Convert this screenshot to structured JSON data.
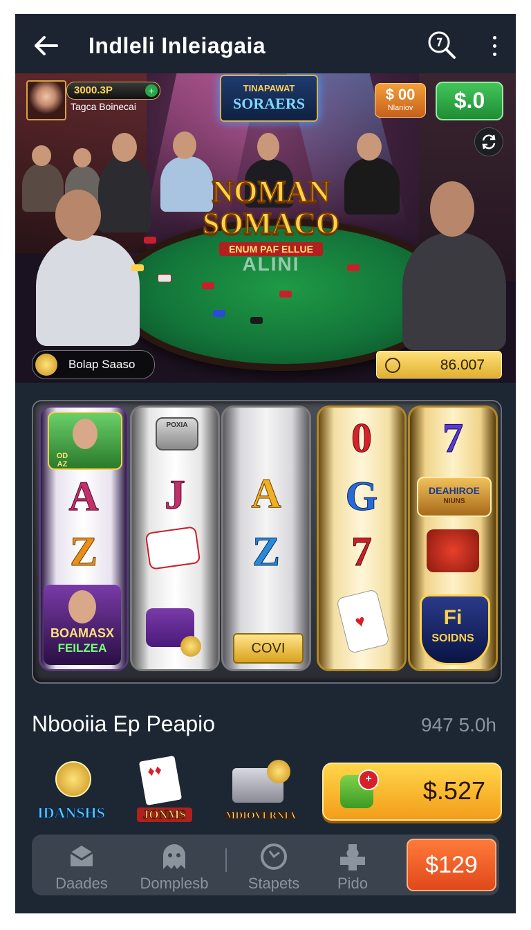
{
  "header": {
    "title": "Indleli Inleiagaia",
    "back_icon": "arrow-left-icon",
    "search_icon": "search-icon",
    "menu_icon": "more-vertical-icon"
  },
  "hero": {
    "player": {
      "balance": "3000.3P",
      "name": "Tagca Boinecai"
    },
    "sign": {
      "line1": "TINAPAWAT",
      "line2": "SORAERS"
    },
    "coin_button": {
      "value": "$ 00",
      "sub": "Nlaniov"
    },
    "cash_button": "$.0",
    "logo": {
      "line1": "NOMAN",
      "line2": "SOMACO",
      "ribbon": "ENUM PAF ELLUE",
      "line3": "ALINI"
    },
    "bonus_pill": "Bolap Saaso",
    "timer_value": "86.007"
  },
  "reels": {
    "reel1": {
      "badge": "OD AZ",
      "symbols": [
        "A",
        "Z"
      ],
      "label_line1": "BOAMASX",
      "label_line2": "FEILZEA"
    },
    "reel2": {
      "chest": "POXIA",
      "symbols": [
        "J"
      ]
    },
    "reel3": {
      "symbols": [
        "A",
        "Z"
      ],
      "button": "COVI"
    },
    "reel4": {
      "symbols": [
        "0",
        "G",
        "7"
      ]
    },
    "reel5": {
      "symbols": [
        "7"
      ],
      "badge": "DEAHIROE",
      "badge_sub": "NIUNS",
      "label_line1": "Fi",
      "label_line2": "SOIDNS"
    }
  },
  "section": {
    "title": "Nbooiia Ep Peapio",
    "meta": "947 5.0h",
    "games": [
      "IDANSHS",
      "JONMS",
      "MDIOVERNIA"
    ],
    "buy_value": "$.527"
  },
  "nav": {
    "items": [
      {
        "label": "Daades",
        "icon": "box-icon"
      },
      {
        "label": "Domplesb",
        "icon": "ghost-icon"
      },
      {
        "label": "Stapets",
        "icon": "refresh-icon"
      },
      {
        "label": "Pido",
        "icon": "puzzle-icon"
      }
    ],
    "cta": "$129"
  },
  "colors": {
    "background": "#1c2733",
    "felt": "#13753a",
    "gold": "#ffd24a",
    "orange_cta": "#e0481a",
    "green_button": "#27a84a"
  }
}
